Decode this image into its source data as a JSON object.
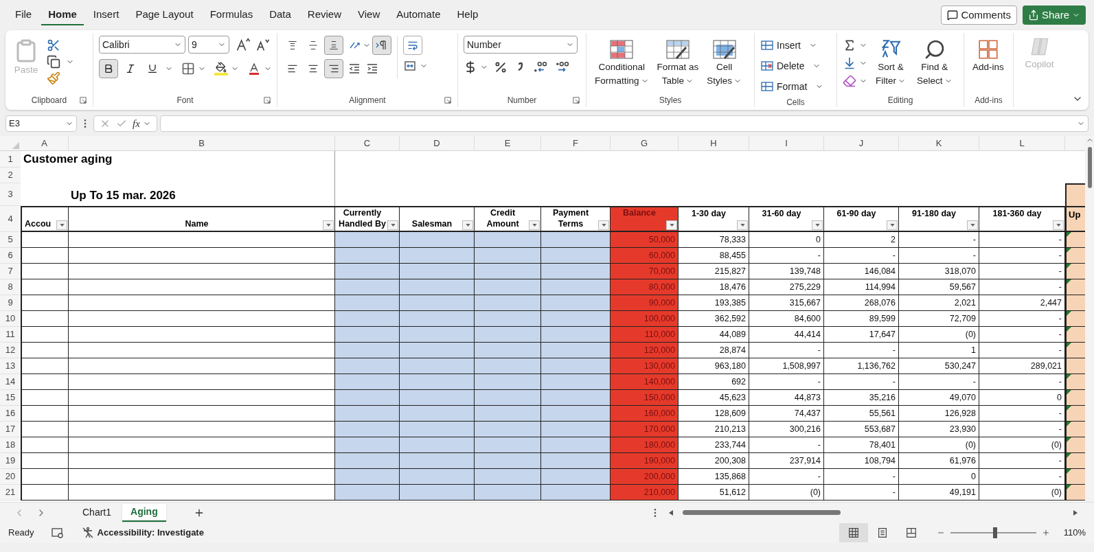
{
  "menu_tabs": [
    {
      "label": "File",
      "selected": false
    },
    {
      "label": "Home",
      "selected": true
    },
    {
      "label": "Insert",
      "selected": false
    },
    {
      "label": "Page Layout",
      "selected": false
    },
    {
      "label": "Formulas",
      "selected": false
    },
    {
      "label": "Data",
      "selected": false
    },
    {
      "label": "Review",
      "selected": false
    },
    {
      "label": "View",
      "selected": false
    },
    {
      "label": "Automate",
      "selected": false
    },
    {
      "label": "Help",
      "selected": false
    }
  ],
  "comments_button": "Comments",
  "share_button": "Share",
  "ribbon": {
    "clipboard": {
      "paste": "Paste",
      "paste_disabled": true,
      "label": "Clipboard"
    },
    "font": {
      "name": "Calibri",
      "size": "9",
      "bold": true,
      "italic": false,
      "underline": false,
      "label": "Font"
    },
    "alignment": {
      "vertical": [
        {
          "selected": false
        },
        {
          "selected": false
        },
        {
          "selected": true
        }
      ],
      "rtl": true,
      "horizontal": [
        {
          "selected": false
        },
        {
          "selected": false
        },
        {
          "selected": true
        }
      ],
      "label": "Alignment"
    },
    "number": {
      "format": "Number",
      "label": "Number"
    },
    "styles": {
      "buttons": [
        {
          "lines": [
            "Conditional",
            "Formatting"
          ]
        },
        {
          "lines": [
            "Format as",
            "Table"
          ]
        },
        {
          "lines": [
            "Cell",
            "Styles"
          ]
        }
      ],
      "label": "Styles"
    },
    "cells": {
      "buttons": [
        "Insert",
        "Delete",
        "Format"
      ],
      "label": "Cells"
    },
    "editing": {
      "buttons": [
        {
          "lines": [
            "Sort &",
            "Filter"
          ]
        },
        {
          "lines": [
            "Find &",
            "Select"
          ]
        }
      ],
      "label": "Editing"
    },
    "addins": {
      "button": "Add-ins",
      "label": "Add-ins"
    },
    "copilot": {
      "label": "Copilot",
      "disabled": true
    }
  },
  "name_box": "E3",
  "function_label": "fx",
  "columns": [
    "A",
    "B",
    "C",
    "D",
    "E",
    "F",
    "G",
    "H",
    "I",
    "J",
    "K",
    "L"
  ],
  "sheet": {
    "title": "Customer aging",
    "subtitle": "Up To 15 mar. 2026",
    "row_numbers": [
      "1",
      "2",
      "3",
      "4",
      "5",
      "6",
      "7",
      "8",
      "9",
      "10",
      "11",
      "12",
      "13",
      "14",
      "15",
      "16",
      "17",
      "18",
      "19",
      "20",
      "21"
    ],
    "headers": [
      {
        "lines": [
          "Accou"
        ]
      },
      {
        "lines": [
          "Name"
        ]
      },
      {
        "lines": [
          "Currently",
          "Handled By"
        ]
      },
      {
        "lines": [
          "Salesman"
        ]
      },
      {
        "lines": [
          "Credit",
          "Amount"
        ]
      },
      {
        "lines": [
          "Payment",
          "Terms"
        ]
      },
      {
        "lines": [
          "Balance"
        ]
      },
      {
        "lines": [
          "1-30 day"
        ]
      },
      {
        "lines": [
          "31-60 day"
        ]
      },
      {
        "lines": [
          "61-90 day"
        ]
      },
      {
        "lines": [
          "91-180 day"
        ]
      },
      {
        "lines": [
          "181-360 day"
        ]
      }
    ],
    "partial_header": "Up",
    "rows": [
      {
        "balance": "50,000",
        "values": [
          "78,333",
          "0",
          "2",
          "-",
          "-"
        ],
        "flag": true
      },
      {
        "balance": "60,000",
        "values": [
          "88,455",
          "-",
          "-",
          "-",
          "-"
        ],
        "flag": true
      },
      {
        "balance": "70,000",
        "values": [
          "215,827",
          "139,748",
          "146,084",
          "318,070",
          "-"
        ],
        "flag": true
      },
      {
        "balance": "80,000",
        "values": [
          "18,476",
          "275,229",
          "114,994",
          "59,567",
          "-"
        ],
        "flag": true
      },
      {
        "balance": "90,000",
        "values": [
          "193,385",
          "315,667",
          "268,076",
          "2,021",
          "2,447"
        ],
        "flag": false
      },
      {
        "balance": "100,000",
        "values": [
          "362,592",
          "84,600",
          "89,599",
          "72,709",
          "-"
        ],
        "flag": true
      },
      {
        "balance": "110,000",
        "values": [
          "44,089",
          "44,414",
          "17,647",
          "(0)",
          "-"
        ],
        "flag": true
      },
      {
        "balance": "120,000",
        "values": [
          "28,874",
          "-",
          "-",
          "1",
          "-"
        ],
        "flag": true
      },
      {
        "balance": "130,000",
        "values": [
          "963,180",
          "1,508,997",
          "1,136,762",
          "530,247",
          "289,021"
        ],
        "flag": false
      },
      {
        "balance": "140,000",
        "values": [
          "692",
          "-",
          "-",
          "-",
          "-"
        ],
        "flag": true
      },
      {
        "balance": "150,000",
        "values": [
          "45,623",
          "44,873",
          "35,216",
          "49,070",
          "0"
        ],
        "flag": true
      },
      {
        "balance": "160,000",
        "values": [
          "128,609",
          "74,437",
          "55,561",
          "126,928",
          "-"
        ],
        "flag": true
      },
      {
        "balance": "170,000",
        "values": [
          "210,213",
          "300,216",
          "553,687",
          "23,930",
          "-"
        ],
        "flag": true
      },
      {
        "balance": "180,000",
        "values": [
          "233,744",
          "-",
          "78,401",
          "(0)",
          "(0)"
        ],
        "flag": true
      },
      {
        "balance": "190,000",
        "values": [
          "200,308",
          "237,914",
          "108,794",
          "61,976",
          "-"
        ],
        "flag": true
      },
      {
        "balance": "200,000",
        "values": [
          "135,868",
          "-",
          "-",
          "0",
          "-"
        ],
        "flag": true
      },
      {
        "balance": "210,000",
        "values": [
          "51,612",
          "(0)",
          "-",
          "49,191",
          "(0)"
        ],
        "flag": true
      }
    ]
  },
  "sheet_tabs": [
    {
      "label": "Chart1",
      "selected": false
    },
    {
      "label": "Aging",
      "selected": true
    }
  ],
  "status": {
    "mode": "Ready",
    "accessibility": "Accessibility: Investigate",
    "views": [
      {
        "selected": true
      },
      {
        "selected": false
      },
      {
        "selected": false
      }
    ],
    "zoom_slider": {
      "level": 0.52
    },
    "zoom": "110%"
  }
}
